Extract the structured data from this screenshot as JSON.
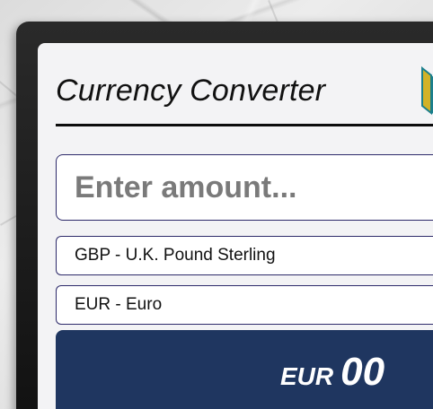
{
  "app": {
    "title": "Currency Converter"
  },
  "amount": {
    "placeholder": "Enter amount...",
    "value": ""
  },
  "from_currency": {
    "selected": "GBP - U.K. Pound Sterling"
  },
  "to_currency": {
    "selected": "EUR - Euro"
  },
  "result": {
    "currency": "EUR",
    "value": "00"
  },
  "colors": {
    "result_background": "#1f3660",
    "field_border": "#2d2a6a",
    "logo_gold": "#d2b228",
    "logo_teal": "#1b7f8c"
  },
  "icons": {
    "logo": "logo-icon"
  }
}
